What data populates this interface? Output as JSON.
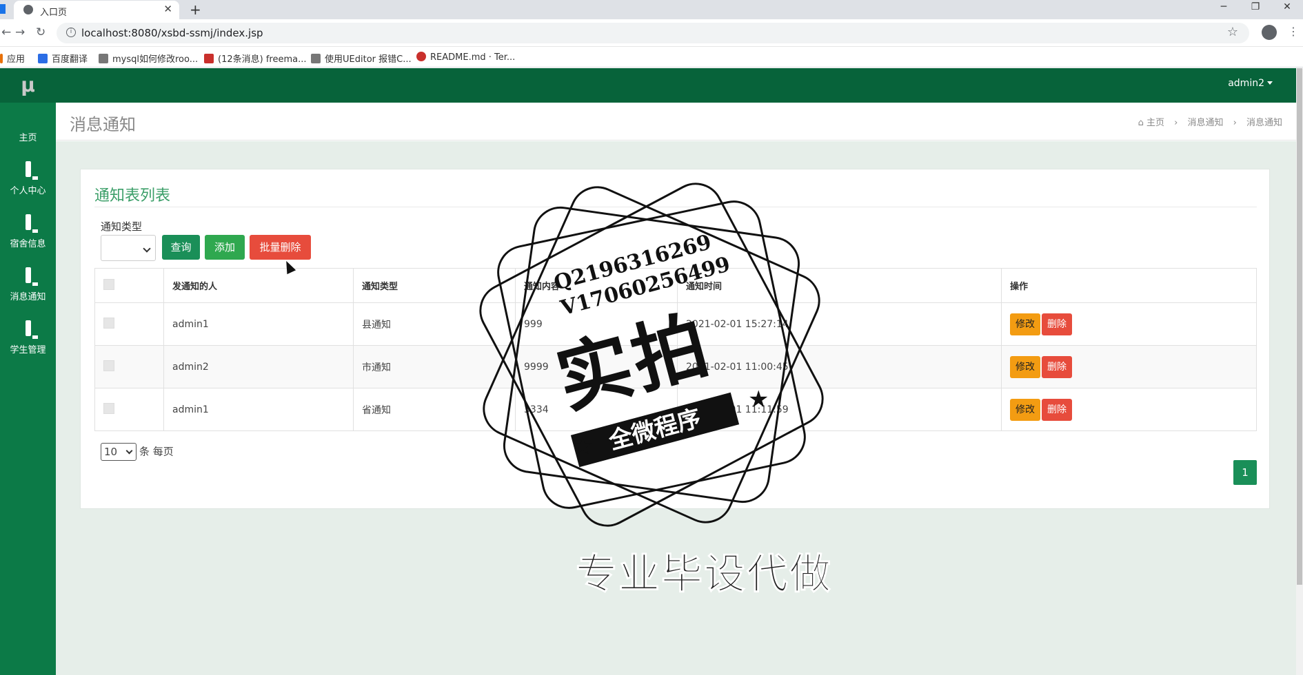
{
  "browser": {
    "tab_title": "入口页",
    "url": "localhost:8080/xsbd-ssmj/index.jsp",
    "bookmarks": [
      {
        "label": "应用",
        "color": "#e8710a"
      },
      {
        "label": "百度翻译",
        "color": "#2b6de5"
      },
      {
        "label": "mysql如何修改roo...",
        "color": "#555555"
      },
      {
        "label": "(12条消息) freema...",
        "color": "#c9302c"
      },
      {
        "label": "使用UEditor 报错C...",
        "color": "#555555"
      },
      {
        "label": "README.md · Ter...",
        "color": "#c9302c"
      }
    ]
  },
  "app": {
    "logo": "μ",
    "user": "admin2",
    "brand_color": "#0c7a47",
    "sidebar": [
      {
        "label": "主页",
        "icon": "dashboard-icon"
      },
      {
        "label": "个人中心",
        "icon": "monitor-icon"
      },
      {
        "label": "宿舍信息",
        "icon": "monitor-icon"
      },
      {
        "label": "消息通知",
        "icon": "monitor-icon"
      },
      {
        "label": "学生管理",
        "icon": "monitor-icon"
      }
    ]
  },
  "page": {
    "title": "消息通知",
    "breadcrumb": [
      "主页",
      "消息通知",
      "消息通知"
    ]
  },
  "list": {
    "title": "通知表列表",
    "filter_label": "通知类型",
    "filter_value": "",
    "buttons": {
      "query": "查询",
      "add": "添加",
      "batch_delete": "批量删除"
    },
    "columns": [
      "",
      "发通知的人",
      "通知类型",
      "通知内容",
      "通知时间",
      "操作"
    ],
    "rows": [
      {
        "sender": "admin1",
        "type": "县通知",
        "content": "999",
        "time": "2021-02-01 15:27:14"
      },
      {
        "sender": "admin2",
        "type": "市通知",
        "content": "9999",
        "time": "2021-02-01 11:00:45"
      },
      {
        "sender": "admin1",
        "type": "省通知",
        "content": "3334",
        "time": "2021-02-01 11:11:59"
      }
    ],
    "row_actions": {
      "edit": "修改",
      "delete": "删除"
    },
    "page_size": "10",
    "page_size_suffix": "条 每页",
    "current_page": "1"
  },
  "watermark": {
    "qq": "Q2196316269",
    "wx": "V17060256499",
    "main": "实拍",
    "ribbon": "全微程序",
    "bottom": "专业毕设代做"
  }
}
